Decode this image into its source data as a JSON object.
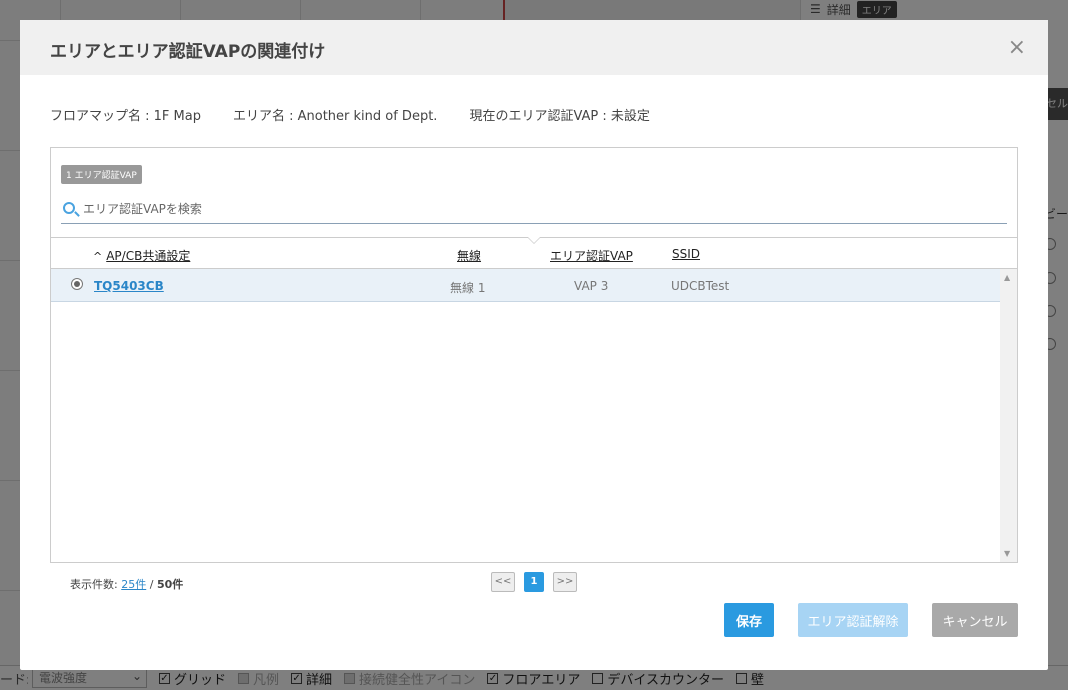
{
  "modal": {
    "title": "エリアとエリア認証VAPの関連付け",
    "close_label": "×",
    "info": {
      "floor_map": "フロアマップ名 : 1F Map",
      "area_name": "エリア名 : Another kind of Dept.",
      "current_vap": "現在のエリア認証VAP : 未設定"
    },
    "vap_badge": "1 エリア認証VAP",
    "search": {
      "placeholder": "エリア認証VAPを検索",
      "value": ""
    },
    "table": {
      "columns": [
        {
          "label": "AP/CB共通設定",
          "sort": "^"
        },
        {
          "label": "無線"
        },
        {
          "label": "エリア認証VAP"
        },
        {
          "label": "SSID"
        }
      ],
      "rows": [
        {
          "selected": true,
          "name": "TQ5403CB",
          "radio": "無線 1",
          "vap": "VAP 3",
          "ssid": "UDCBTest"
        }
      ]
    },
    "footer": {
      "count_label": "表示件数:",
      "per_page": "25件",
      "separator": "/",
      "total": "50件"
    },
    "pager": {
      "prev": "<<",
      "current": "1",
      "next": ">>"
    },
    "buttons": {
      "save": "保存",
      "release": "エリア認証解除",
      "cancel": "キャンセル"
    }
  },
  "background": {
    "top_tools": {
      "detail": "詳細",
      "tag": "エリア"
    },
    "right_cut_button": "セル",
    "right_cut_text": "ビー",
    "bottom_bar": {
      "cut_label": "ード:",
      "select_value": "電波強度",
      "checks": [
        {
          "label": "グリッド",
          "checked": true,
          "disabled": false
        },
        {
          "label": "凡例",
          "checked": false,
          "disabled": true
        },
        {
          "label": "詳細",
          "checked": true,
          "disabled": false
        },
        {
          "label": "接続健全性アイコン",
          "checked": false,
          "disabled": true
        },
        {
          "label": "フロアエリア",
          "checked": true,
          "disabled": false
        },
        {
          "label": "デバイスカウンター",
          "checked": false,
          "disabled": false
        },
        {
          "label": "壁",
          "checked": false,
          "disabled": false
        }
      ]
    }
  },
  "colors": {
    "accent": "#2a9ae0",
    "link": "#2a86c8",
    "release_disabled": "#a7d4f4",
    "cancel": "#a9a9a9",
    "row_selected": "#e9f1f8"
  }
}
